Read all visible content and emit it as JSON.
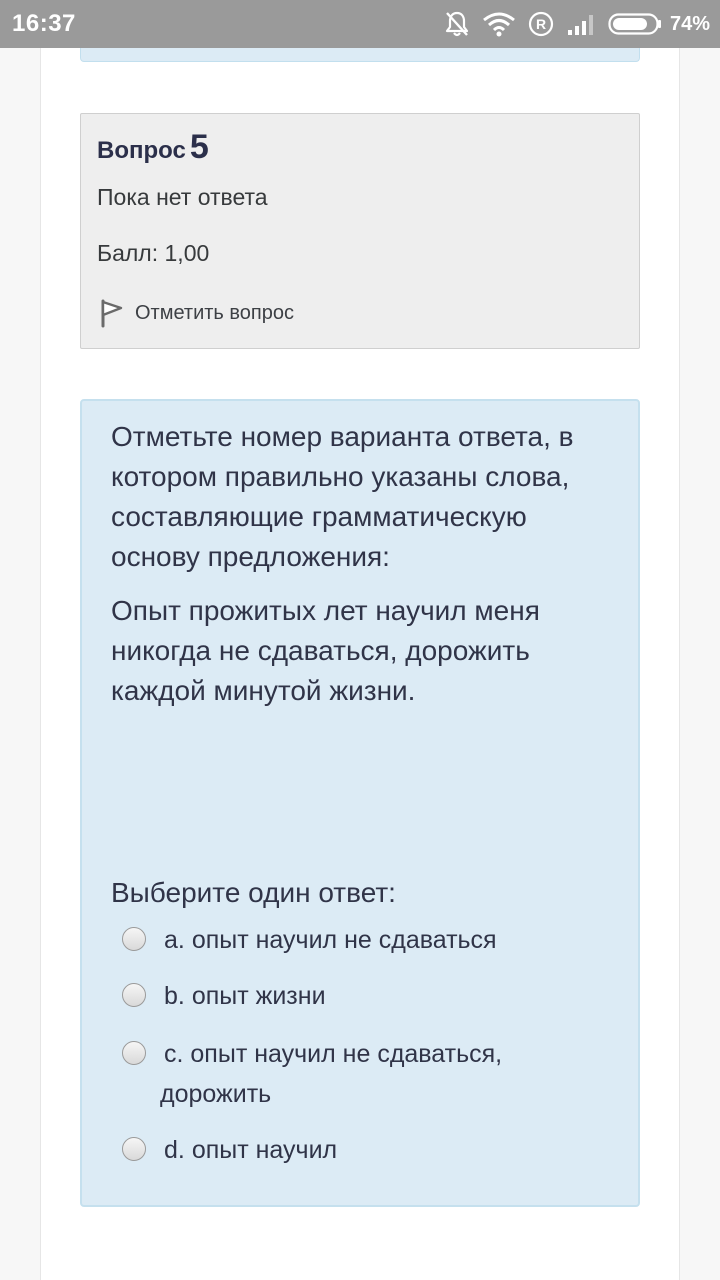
{
  "status_bar": {
    "time": "16:37",
    "battery": "74%",
    "icons": [
      "mute-bell-icon",
      "wifi-icon",
      "roaming-r-icon",
      "signal-icon",
      "battery-icon"
    ]
  },
  "question_info": {
    "label": "Вопрос",
    "number": "5",
    "state": "Пока нет ответа",
    "grade": "Балл: 1,00",
    "flag_label": "Отметить вопрос",
    "flag_icon": "flag-icon"
  },
  "question": {
    "text": "Отметьте номер варианта ответа, в котором правильно указаны слова, составляющие грамматическую основу предложения:",
    "sentence": "Опыт прожитых лет научил меня никогда не сдаваться, дорожить каждой минутой жизни.",
    "prompt": "Выберите один ответ:",
    "answers": [
      {
        "letter": "a.",
        "text": "опыт научил не сдаваться"
      },
      {
        "letter": "b.",
        "text": "опыт жизни"
      },
      {
        "letter": "c.",
        "text": "опыт научил не сдаваться, дорожить"
      },
      {
        "letter": "d.",
        "text": "опыт научил"
      }
    ]
  },
  "colors": {
    "status_bar_bg": "#9a9a9a",
    "info_card_bg": "#eeeeee",
    "question_bg": "#dcebf5",
    "question_border": "#c5e0ee",
    "title_text": "#2b2f4a"
  }
}
